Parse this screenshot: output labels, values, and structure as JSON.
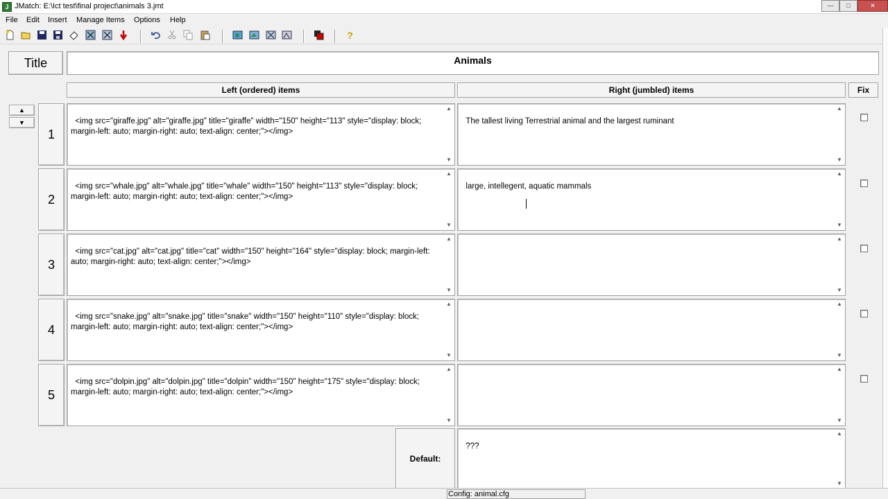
{
  "window": {
    "title": "JMatch: E:\\Ict test\\final project\\animals 3.jmt",
    "app_icon": "jmatch-app-icon",
    "buttons": {
      "minimize": "—",
      "maximize": "□",
      "close": "✕"
    }
  },
  "menubar": {
    "items": [
      "File",
      "Edit",
      "Insert",
      "Manage Items",
      "Options",
      "Help"
    ]
  },
  "toolbar": {
    "icons": [
      "new-file-icon",
      "open-file-icon",
      "save-icon",
      "save-as-icon",
      "clear-icon",
      "export-web-icon",
      "export-web-alt-icon",
      "add-item-icon",
      "undo-icon",
      "cut-icon",
      "copy-icon",
      "paste-icon",
      "web-page-icon",
      "drag-drop-page-icon",
      "flashcard-page-icon",
      "export-icon",
      "translate-icon",
      "help-icon"
    ],
    "help_glyph": "?"
  },
  "exercise": {
    "title_label": "Title",
    "title_value": "Animals"
  },
  "columns": {
    "left": "Left (ordered) items",
    "right": "Right (jumbled) items",
    "fix": "Fix"
  },
  "arrows": {
    "up": "▲",
    "down": "▼"
  },
  "rows": [
    {
      "number": "1",
      "left": "<img src=\"giraffe.jpg\" alt=\"giraffe.jpg\" title=\"giraffe\" width=\"150\" height=\"113\" style=\"display: block; margin-left: auto; margin-right: auto; text-align: center;\"></img>",
      "right": "The tallest living Terrestrial animal and the largest ruminant"
    },
    {
      "number": "2",
      "left": "<img src=\"whale.jpg\" alt=\"whale.jpg\" title=\"whale\" width=\"150\" height=\"113\" style=\"display: block; margin-left: auto; margin-right: auto; text-align: center;\"></img>",
      "right": "large, intellegent, aquatic mammals"
    },
    {
      "number": "3",
      "left": "<img src=\"cat.jpg\" alt=\"cat.jpg\" title=\"cat\" width=\"150\" height=\"164\" style=\"display: block; margin-left: auto; margin-right: auto; text-align: center;\"></img>",
      "right": ""
    },
    {
      "number": "4",
      "left": "<img src=\"snake.jpg\" alt=\"snake.jpg\" title=\"snake\" width=\"150\" height=\"110\" style=\"display: block; margin-left: auto; margin-right: auto; text-align: center;\"></img>",
      "right": ""
    },
    {
      "number": "5",
      "left": "<img src=\"dolpin.jpg\" alt=\"dolpin.jpg\" title=\"dolpin\" width=\"150\" height=\"175\" style=\"display: block; margin-left: auto; margin-right: auto; text-align: center;\"></img>",
      "right": ""
    }
  ],
  "default": {
    "label": "Default:",
    "value": "???"
  },
  "status": {
    "config": "Config: animal.cfg"
  }
}
